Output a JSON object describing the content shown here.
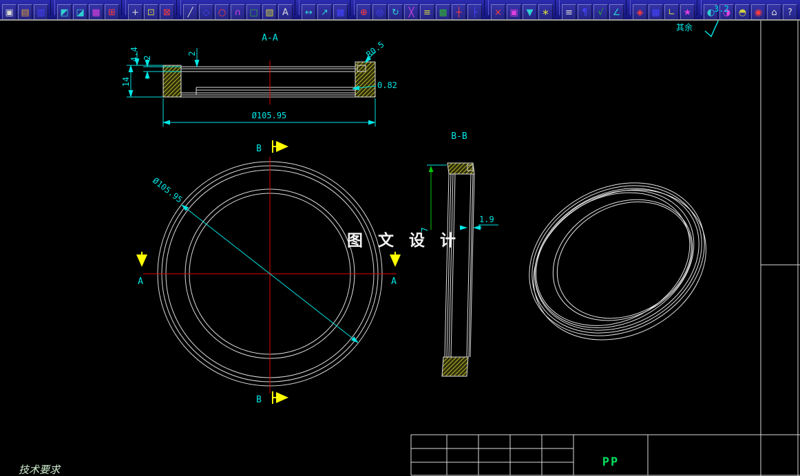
{
  "toolbar": {
    "icons": [
      {
        "n": "new-file-icon",
        "g": "▣",
        "c": "#d8d8d8"
      },
      {
        "n": "open-file-icon",
        "g": "▤",
        "c": "#e0a030"
      },
      {
        "n": "save-icon",
        "g": "▥",
        "c": "#4444ff"
      },
      {
        "sep": true
      },
      {
        "n": "undo-icon",
        "g": "◩",
        "c": "#30d0d0"
      },
      {
        "n": "redo-icon",
        "g": "◪",
        "c": "#30d0d0"
      },
      {
        "n": "print-icon",
        "g": "▦",
        "c": "#e040e0"
      },
      {
        "n": "plot-icon",
        "g": "⊞",
        "c": "#ff3c3c"
      },
      {
        "sep": true
      },
      {
        "n": "pan-icon",
        "g": "+",
        "c": "#d8d8d8"
      },
      {
        "n": "zoom-window-icon",
        "g": "⊡",
        "c": "#d0d040"
      },
      {
        "n": "zoom-extents-icon",
        "g": "⊠",
        "c": "#ff3c3c"
      },
      {
        "sep": true
      },
      {
        "n": "line-tool-icon",
        "g": "╱",
        "c": "#d8d8d8"
      },
      {
        "n": "polyline-tool-icon",
        "g": "◇",
        "c": "#4444ff"
      },
      {
        "n": "circle-tool-icon",
        "g": "○",
        "c": "#ff3c3c"
      },
      {
        "n": "arc-tool-icon",
        "g": "∩",
        "c": "#e040e0"
      },
      {
        "n": "rectangle-tool-icon",
        "g": "□",
        "c": "#30b030"
      },
      {
        "n": "hatch-tool-icon",
        "g": "▨",
        "c": "#d0d040"
      },
      {
        "n": "text-tool-icon",
        "g": "A",
        "c": "#d8d8d8"
      },
      {
        "sep": true
      },
      {
        "n": "dimension-icon",
        "g": "↔",
        "c": "#30d0d0"
      },
      {
        "n": "leader-icon",
        "g": "↗",
        "c": "#30d0d0"
      },
      {
        "n": "table-icon",
        "g": "▦",
        "c": "#4444ff"
      },
      {
        "sep": true
      },
      {
        "n": "move-icon",
        "g": "⊕",
        "c": "#ff3c3c"
      },
      {
        "n": "copy-icon",
        "g": "◎",
        "c": "#4444ff"
      },
      {
        "n": "rotate-icon",
        "g": "↻",
        "c": "#30d0d0"
      },
      {
        "n": "mirror-icon",
        "g": "╳",
        "c": "#e040e0"
      },
      {
        "n": "offset-icon",
        "g": "≡",
        "c": "#d0d040"
      },
      {
        "n": "array-icon",
        "g": "▩",
        "c": "#30b030"
      },
      {
        "n": "trim-icon",
        "g": "┼",
        "c": "#ff3c3c"
      },
      {
        "n": "extend-icon",
        "g": "├",
        "c": "#4444ff"
      },
      {
        "sep": true
      },
      {
        "n": "erase-icon",
        "g": "×",
        "c": "#ff3c3c"
      },
      {
        "n": "block-icon",
        "g": "▣",
        "c": "#e040e0"
      },
      {
        "n": "insert-icon",
        "g": "▼",
        "c": "#30d0d0"
      },
      {
        "n": "explode-icon",
        "g": "∗",
        "c": "#d0d040"
      },
      {
        "sep": true
      },
      {
        "n": "layers-icon",
        "g": "≡",
        "c": "#d8d8d8"
      },
      {
        "n": "properties-icon",
        "g": "¶",
        "c": "#4444ff"
      },
      {
        "n": "match-properties-icon",
        "g": "√",
        "c": "#30b030"
      },
      {
        "n": "measure-icon",
        "g": "∠",
        "c": "#30d0d0"
      },
      {
        "sep": true
      },
      {
        "n": "osnap-icon",
        "g": "◈",
        "c": "#ff3c3c"
      },
      {
        "n": "grid-icon",
        "g": "▦",
        "c": "#4444ff"
      },
      {
        "n": "ortho-icon",
        "g": "∟",
        "c": "#d0d040"
      },
      {
        "n": "polar-icon",
        "g": "★",
        "c": "#e040e0"
      },
      {
        "sep": true
      },
      {
        "n": "view-3d-icon",
        "g": "◐",
        "c": "#30d0d0"
      },
      {
        "n": "render-icon",
        "g": "◑",
        "c": "#e040e0"
      },
      {
        "n": "lights-icon",
        "g": "◓",
        "c": "#d0d040"
      },
      {
        "n": "camera-icon",
        "g": "◉",
        "c": "#ff3c3c"
      },
      {
        "n": "home-view-icon",
        "g": "⌂",
        "c": "#d8d8d8"
      },
      {
        "n": "help-icon",
        "g": "?",
        "c": "#d8d8d8"
      }
    ]
  },
  "surface_note": {
    "label": "其余",
    "value": "3.2"
  },
  "views": {
    "section_aa": {
      "title": "A-A",
      "dim_44": "4.4",
      "dim_2_wall": "2",
      "dim_14": "14",
      "dim_2_top": "2",
      "dim_r05": "R0.5",
      "dim_082": "0.82",
      "dim_dia": "Ø105.95"
    },
    "top_view": {
      "dim_dia": "Ø105.95",
      "label_a": "A",
      "label_b": "B"
    },
    "section_bb": {
      "title": "B-B",
      "dim_7": "7",
      "dim_19": "1.9"
    },
    "watermark": "图 文 设 计"
  },
  "notes": {
    "tech_req": "技术要求"
  },
  "title_block": {
    "material": "PP"
  },
  "colors": {
    "dimension": "#00e5e5",
    "centerline": "#e00000",
    "section_marker": "#ffff00",
    "outline": "#dedede",
    "material_text": "#00e060",
    "hatch": "#c8c832"
  }
}
